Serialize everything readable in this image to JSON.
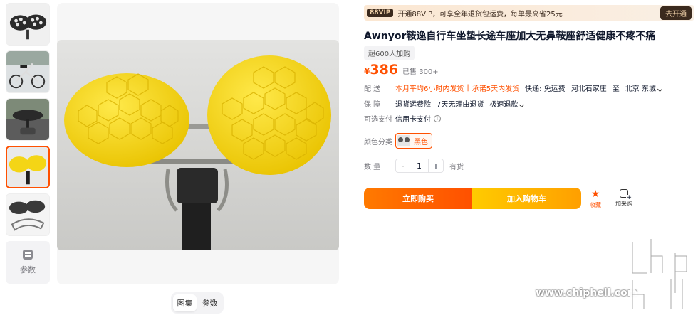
{
  "gallery": {
    "thumbnails": [
      "saddle-black-top",
      "bike-photo",
      "saddle-on-bike",
      "saddle-yellow",
      "saddle-frame-gray"
    ],
    "params_label": "参数",
    "tabs": [
      "图集",
      "参数"
    ]
  },
  "vip": {
    "badge": "88VIP",
    "text": "开通88VIP，可享全年退货包运费，每单最高省25元",
    "button": "去开通"
  },
  "product": {
    "title": "Awnyor鞍逸自行车坐垫长途车座加大无鼻鞍座舒适健康不疼不痛",
    "badge": "超600人加购",
    "currency": "¥",
    "price": "386",
    "sold": "已售 300+"
  },
  "delivery": {
    "label": "配 送",
    "promise_1": "本月平均6小时内发货",
    "promise_2": "承诺5天内发货",
    "shipping": "快递: 免运费",
    "from": "河北石家庄",
    "to_word": "至",
    "dest": "北京 东城"
  },
  "guarantee": {
    "label": "保 障",
    "items": [
      "退货运费险",
      "7天无理由退货",
      "极速退款"
    ]
  },
  "payment": {
    "label": "可选支付",
    "value": "信用卡支付"
  },
  "color": {
    "label": "颜色分类",
    "selected": "黑色"
  },
  "quantity": {
    "label": "数 量",
    "minus": "-",
    "value": "1",
    "plus": "+",
    "stock": "有货"
  },
  "actions": {
    "buy": "立即购买",
    "add_to_cart": "加入购物车",
    "favorite": "收藏",
    "add_purchase": "加采购"
  },
  "watermark": {
    "url": "www.chiphell.com"
  },
  "colors": {
    "accent": "#ff5000",
    "cart_gradient_end": "#ffcb00",
    "text": "#11192d"
  }
}
